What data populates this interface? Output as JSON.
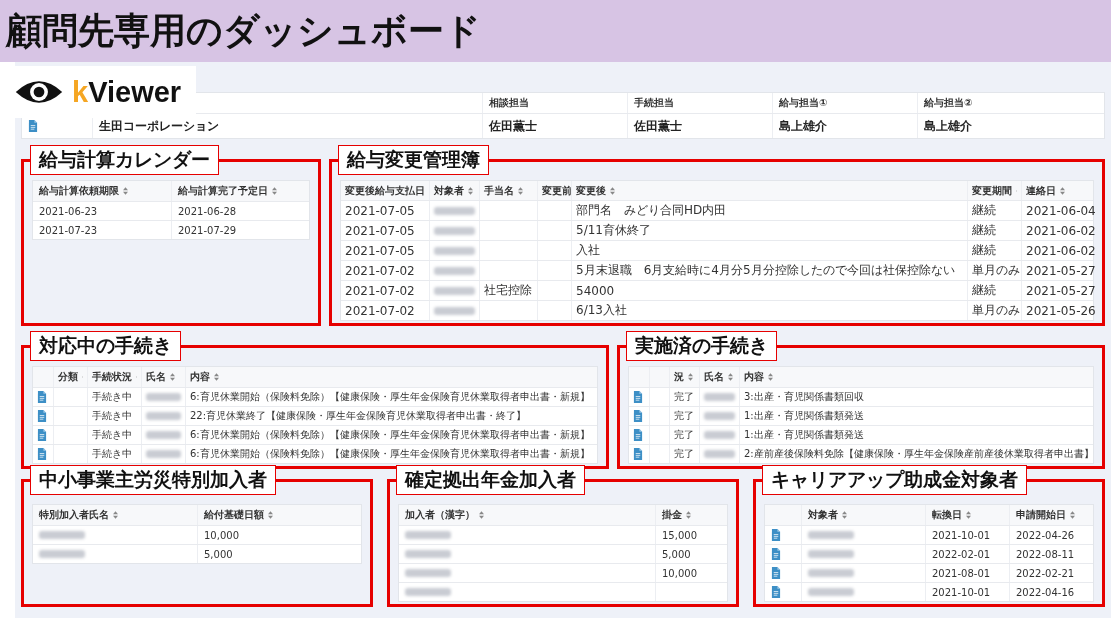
{
  "slide_title": "顧問先専用のダッシュボード",
  "logo": {
    "text": "kViewer"
  },
  "client_info": {
    "columns": [
      {
        "kind": "blank"
      },
      {
        "kind": "blank"
      },
      {
        "kind": "plain",
        "label": "相談担当"
      },
      {
        "kind": "plain",
        "label": "手続担当"
      },
      {
        "kind": "plain",
        "label": "給与担当①"
      },
      {
        "kind": "plain",
        "label": "給与担当②"
      }
    ],
    "rows": [
      [
        {
          "kind": "doc"
        },
        "生田コーポレーション",
        "佐田薫士",
        "佐田薫士",
        "島上雄介",
        "島上雄介"
      ]
    ]
  },
  "sections": [
    {
      "title": "給与計算カレンダー",
      "columns": [
        {
          "kind": "label",
          "label": "給与計算依頼期限"
        },
        {
          "kind": "label",
          "label": "給与計算完了予定日"
        }
      ],
      "rows": [
        [
          "2021-06-23",
          "2021-06-28"
        ],
        [
          "2021-07-23",
          "2021-07-29"
        ]
      ]
    },
    {
      "title": "給与変更管理簿",
      "columns": [
        {
          "kind": "label",
          "label": "変更後給与支払日"
        },
        {
          "kind": "label",
          "label": "対象者"
        },
        {
          "kind": "label",
          "label": "手当名"
        },
        {
          "kind": "label",
          "label": "変更前"
        },
        {
          "kind": "label",
          "label": "変更後"
        },
        {
          "kind": "label",
          "label": "変更期間"
        },
        {
          "kind": "label",
          "label": "連絡日"
        }
      ],
      "rows": [
        [
          "2021-07-05",
          {
            "kind": "blurred"
          },
          null,
          null,
          "部門名　みどり合同HD内田",
          "継続",
          "2021-06-04"
        ],
        [
          "2021-07-05",
          {
            "kind": "blurred"
          },
          null,
          null,
          "5/11育休終了",
          "継続",
          "2021-06-02"
        ],
        [
          "2021-07-05",
          {
            "kind": "blurred"
          },
          null,
          null,
          "入社",
          "継続",
          "2021-06-02"
        ],
        [
          "2021-07-02",
          {
            "kind": "blurred"
          },
          null,
          null,
          "5月末退職　6月支給時に4月分5月分控除したので今回は社保控除ない",
          "単月のみ",
          "2021-05-27"
        ],
        [
          "2021-07-02",
          {
            "kind": "blurred"
          },
          "社宅控除",
          null,
          "54000",
          "継続",
          "2021-05-27"
        ],
        [
          "2021-07-02",
          {
            "kind": "blurred"
          },
          null,
          null,
          "6/13入社",
          "単月のみ",
          "2021-05-26"
        ]
      ]
    },
    {
      "title": "対応中の手続き",
      "columns": [
        {
          "kind": "blank"
        },
        {
          "kind": "label",
          "label": "分類"
        },
        {
          "kind": "label",
          "label": "手続状況"
        },
        {
          "kind": "label",
          "label": "氏名"
        },
        {
          "kind": "label",
          "label": "内容"
        }
      ],
      "rows": [
        [
          {
            "kind": "doc"
          },
          null,
          "手続き中",
          {
            "kind": "blurred"
          },
          "6:育児休業開始（保険料免除）【健康保険・厚生年金保険育児休業取得者申出書・新規】"
        ],
        [
          {
            "kind": "doc"
          },
          null,
          "手続き中",
          {
            "kind": "blurred"
          },
          "22:育児休業終了【健康保険・厚生年金保険育児休業取得者申出書・終了】"
        ],
        [
          {
            "kind": "doc"
          },
          null,
          "手続き中",
          {
            "kind": "blurred"
          },
          "6:育児休業開始（保険料免除）【健康保険・厚生年金保険育児休業取得者申出書・新規】"
        ],
        [
          {
            "kind": "doc"
          },
          null,
          "手続き中",
          {
            "kind": "blurred"
          },
          "6:育児休業開始（保険料免除）【健康保険・厚生年金保険育児休業取得者申出書・新規】"
        ]
      ]
    },
    {
      "title": "実施済の手続き",
      "columns": [
        {
          "kind": "blank"
        },
        {
          "kind": "blank"
        },
        {
          "kind": "label",
          "label": "況"
        },
        {
          "kind": "label",
          "label": "氏名"
        },
        {
          "kind": "label",
          "label": "内容"
        }
      ],
      "rows": [
        [
          {
            "kind": "doc"
          },
          null,
          "完了",
          {
            "kind": "blurred"
          },
          "3:出産・育児関係書類回収"
        ],
        [
          {
            "kind": "doc"
          },
          null,
          "完了",
          {
            "kind": "blurred"
          },
          "1:出産・育児関係書類発送"
        ],
        [
          {
            "kind": "doc"
          },
          null,
          "完了",
          {
            "kind": "blurred"
          },
          "1:出産・育児関係書類発送"
        ],
        [
          {
            "kind": "doc"
          },
          null,
          "完了",
          {
            "kind": "blurred"
          },
          "2:産前産後保険料免除【健康保険・厚生年金保険産前産後休業取得者申出書】"
        ]
      ]
    },
    {
      "title": "中小事業主労災特別加入者",
      "columns": [
        {
          "kind": "label",
          "label": "特別加入者氏名"
        },
        {
          "kind": "label",
          "label": "給付基礎日額"
        }
      ],
      "rows": [
        [
          {
            "kind": "blurred"
          },
          "10,000"
        ],
        [
          {
            "kind": "blurred"
          },
          "5,000"
        ]
      ]
    },
    {
      "title": "確定拠出年金加入者",
      "columns": [
        {
          "kind": "label",
          "label": "加入者（漢字）"
        },
        {
          "kind": "label",
          "label": "掛金"
        }
      ],
      "rows": [
        [
          {
            "kind": "blurred"
          },
          "15,000"
        ],
        [
          {
            "kind": "blurred"
          },
          "5,000"
        ],
        [
          {
            "kind": "blurred"
          },
          "10,000"
        ],
        [
          {
            "kind": "blurred"
          },
          null
        ]
      ]
    },
    {
      "title": "キャリアアップ助成金対象者",
      "columns": [
        {
          "kind": "blank"
        },
        {
          "kind": "label",
          "label": "対象者"
        },
        {
          "kind": "label",
          "label": "転換日"
        },
        {
          "kind": "label",
          "label": "申請開始日"
        }
      ],
      "rows": [
        [
          {
            "kind": "doc"
          },
          {
            "kind": "blurred"
          },
          "2021-10-01",
          "2022-04-26"
        ],
        [
          {
            "kind": "doc"
          },
          {
            "kind": "blurred"
          },
          "2022-02-01",
          "2022-08-11"
        ],
        [
          {
            "kind": "doc"
          },
          {
            "kind": "blurred"
          },
          "2021-08-01",
          "2022-02-21"
        ],
        [
          {
            "kind": "doc"
          },
          {
            "kind": "blurred"
          },
          "2021-10-01",
          "2022-04-16"
        ]
      ]
    }
  ]
}
